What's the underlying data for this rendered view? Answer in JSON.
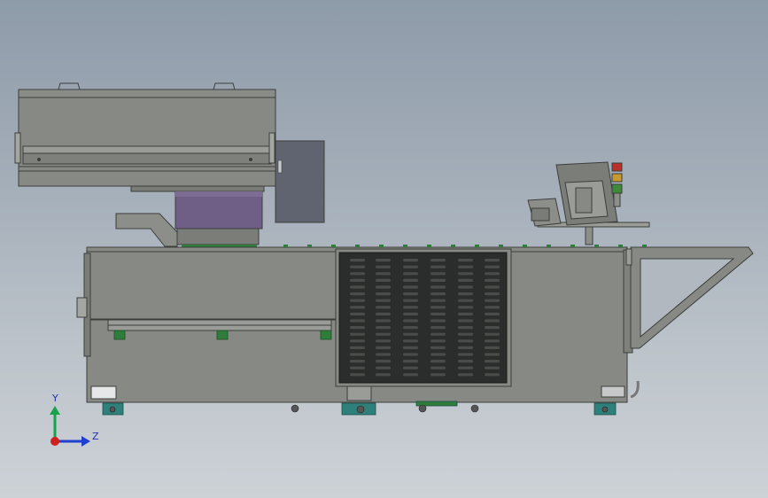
{
  "axis_triad": {
    "y_label": "Y",
    "z_label": "Z",
    "colors": {
      "y": "#17a34a",
      "z": "#1f3fd0",
      "x": "#d01f1f"
    }
  },
  "palette": {
    "body": "#878985",
    "body_dark": "#6f716d",
    "outline": "#3c3e3b",
    "vent_panel": "#2b2d2c",
    "slot": "#4a4c4a",
    "purple_block": "#6f5f86",
    "cabinet": "#5f6470",
    "green_part": "#2f7d3a",
    "foot": "#2f7f7a",
    "beacon": [
      "#b8322a",
      "#c69a2e",
      "#3f8a3a"
    ]
  }
}
